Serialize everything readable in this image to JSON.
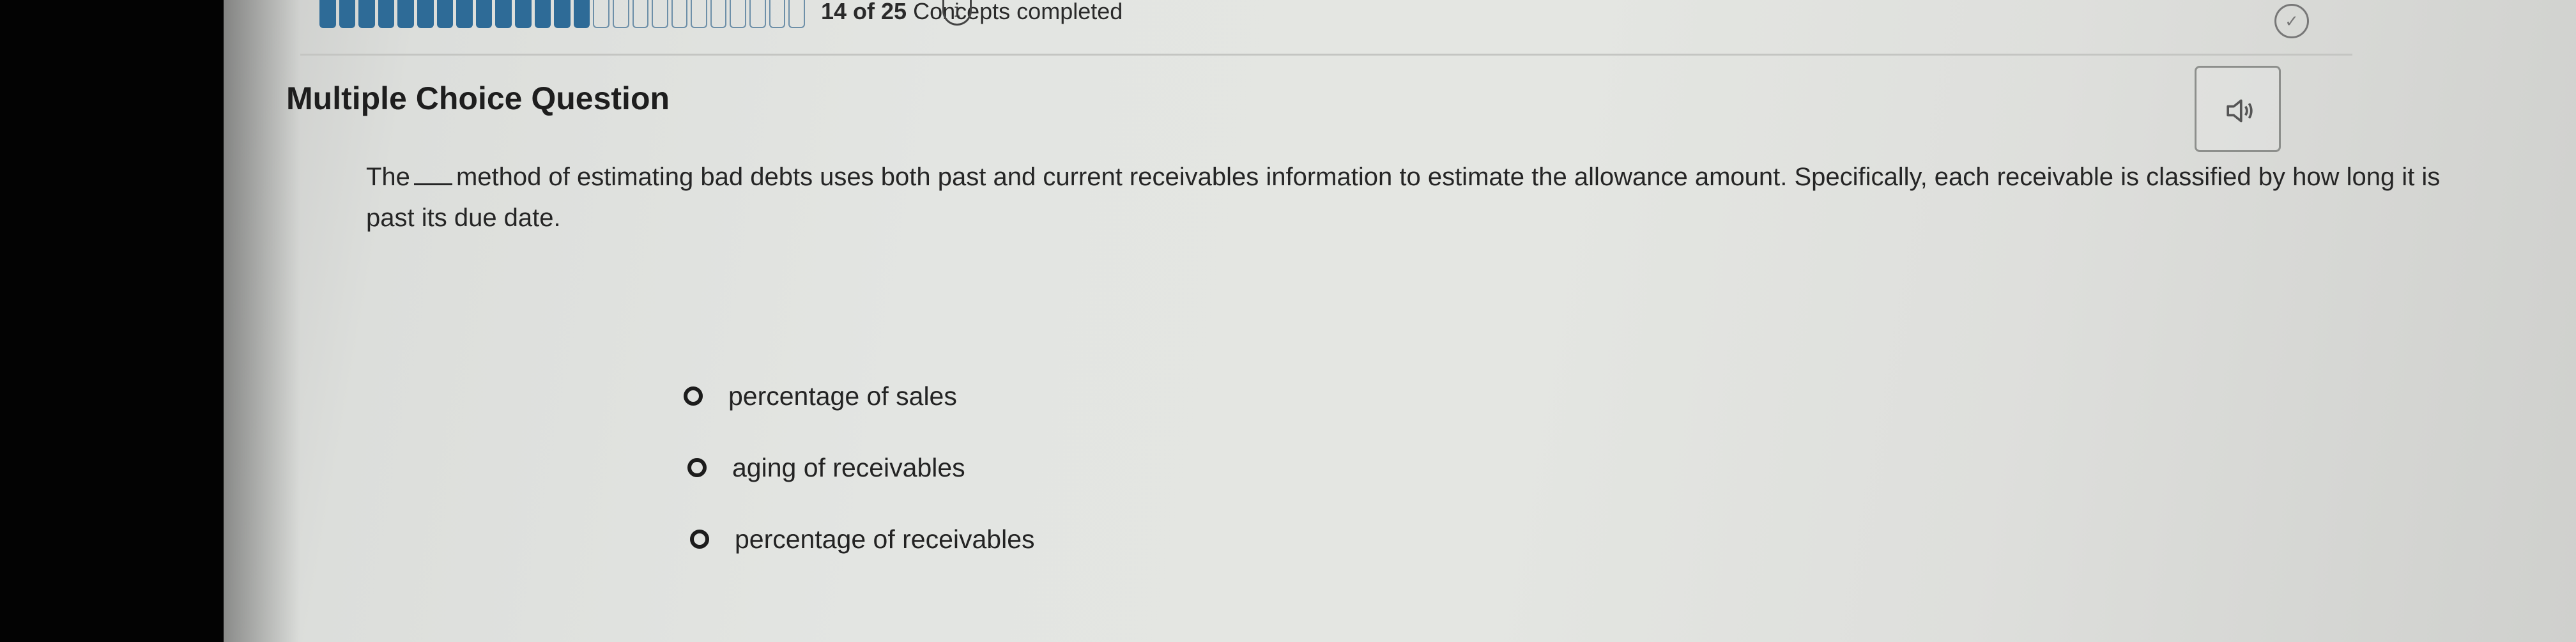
{
  "progress": {
    "completed": 14,
    "total": 25,
    "count_text": "14 of 25",
    "label_text": "Concepts completed"
  },
  "icons": {
    "info": "info-icon",
    "check": "check-circle-icon",
    "audio": "speaker-icon"
  },
  "info_glyph": "i",
  "check_glyph": "✓",
  "question": {
    "heading": "Multiple Choice Question",
    "text_before_blank": "The",
    "text_after_blank": "method of estimating bad debts uses both past and current receivables information to estimate the allowance amount. Specifically, each receivable is classified by how long it is past its due date."
  },
  "options": [
    {
      "label": "percentage of sales"
    },
    {
      "label": "aging of receivables"
    },
    {
      "label": "percentage of receivables"
    }
  ],
  "colors": {
    "progress_done": "#2e6b97",
    "progress_todo": "#6d8fa8",
    "text": "#252525"
  }
}
